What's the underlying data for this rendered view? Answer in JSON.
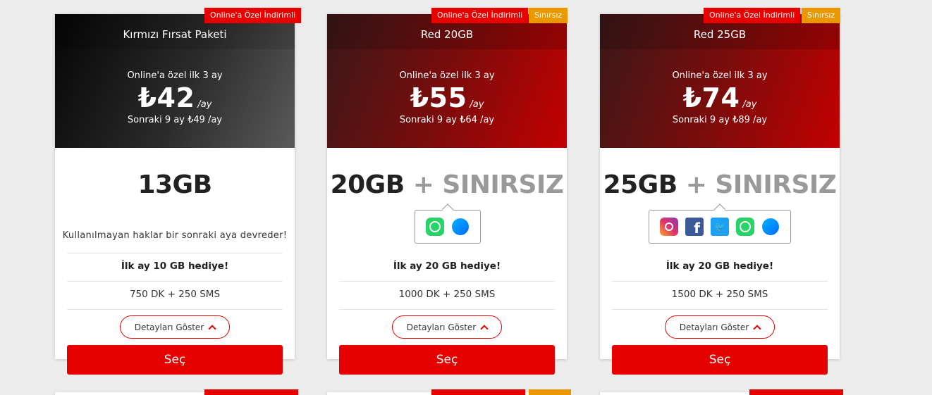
{
  "cards": [
    {
      "title": "Kırmızı Fırsat Paketi",
      "badge_online": "Online'a Özel İndirimli",
      "promo": "Online'a özel ilk 3 ay",
      "price": "₺42",
      "per": "/ay",
      "later": "Sonraki 9 ay ₺49 /ay",
      "data": "13GB",
      "rollover": "Kullanılmayan haklar bir sonraki aya devreder!",
      "gift": "İlk ay 10 GB hediye!",
      "minutes": "750 DK + 250 SMS",
      "details": "Detayları Göster",
      "select": "Seç"
    },
    {
      "title": "Red 20GB",
      "badge_online": "Online'a Özel İndirimli",
      "badge_unlimited": "Sınırsız",
      "promo": "Online'a özel ilk 3 ay",
      "price": "₺55",
      "per": "/ay",
      "later": "Sonraki 9 ay ₺64 /ay",
      "data": "20GB",
      "plus": "+ SINIRSIZ",
      "apps": [
        "whatsapp-icon",
        "messenger-icon"
      ],
      "gift": "İlk ay 20 GB hediye!",
      "minutes": "1000 DK + 250 SMS",
      "details": "Detayları Göster",
      "select": "Seç"
    },
    {
      "title": "Red 25GB",
      "badge_online": "Online'a Özel İndirimli",
      "badge_unlimited": "Sınırsız",
      "promo": "Online'a özel ilk 3 ay",
      "price": "₺74",
      "per": "/ay",
      "later": "Sonraki 9 ay ₺89 /ay",
      "data": "25GB",
      "plus": "+ SINIRSIZ",
      "apps": [
        "instagram-icon",
        "facebook-icon",
        "twitter-icon",
        "whatsapp-icon",
        "messenger-icon"
      ],
      "gift": "İlk ay 20 GB hediye!",
      "minutes": "1500 DK + 250 SMS",
      "details": "Detayları Göster",
      "select": "Seç"
    }
  ],
  "colors": {
    "accent_red": "#e60000",
    "unlimited_orange": "#eb9700",
    "page_bg": "#ececec"
  }
}
